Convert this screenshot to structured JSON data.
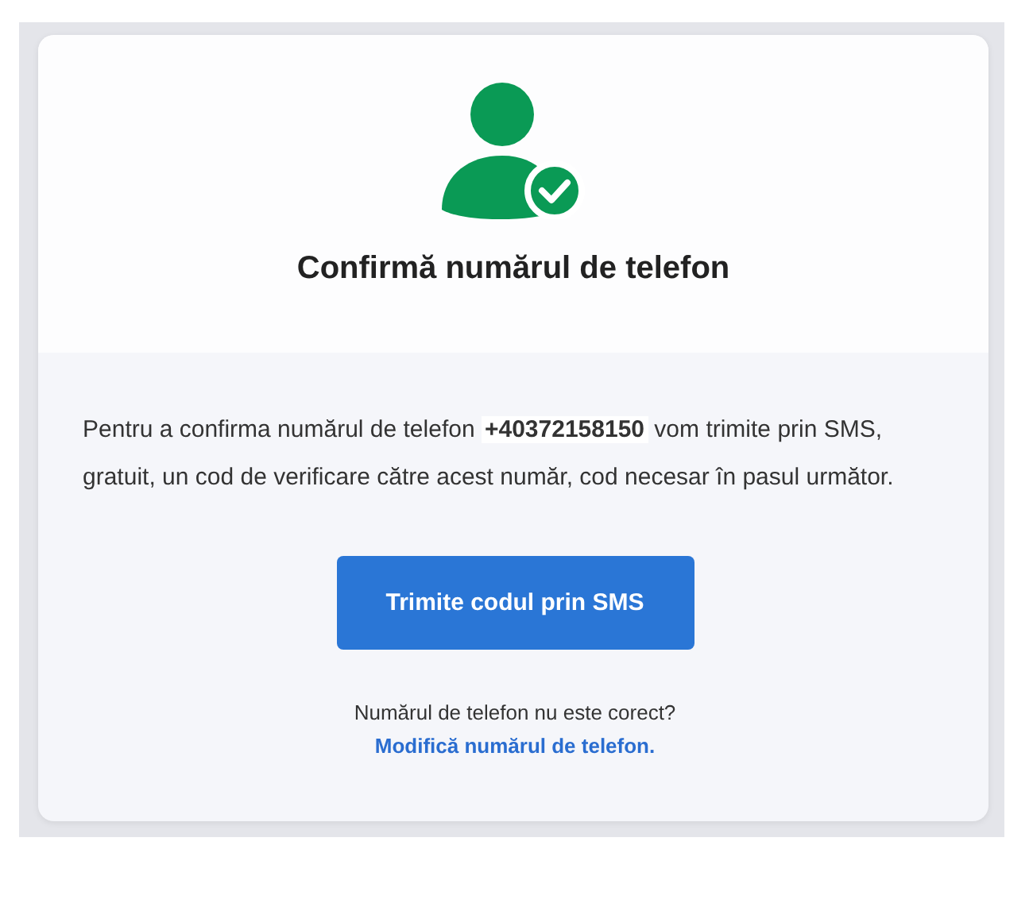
{
  "card": {
    "title": "Confirmă numărul de telefon",
    "message": "Pentru a confirma numărul de telefon **+40372158150** vom trimite prin SMS, gratuit, un cod de verificare către acest număr, cod necesar în pasul următor.",
    "button": "Trimite codul prin SMS",
    "question": "Numărul de telefon nu este corect?",
    "link": "Modifică numărul de telefon."
  }
}
